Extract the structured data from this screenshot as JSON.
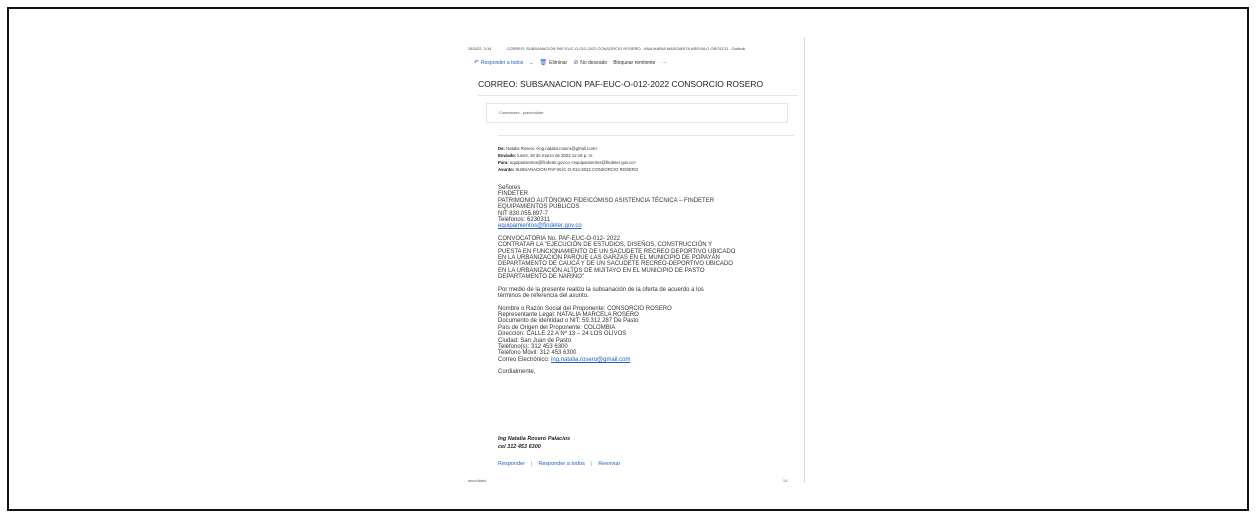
{
  "header": {
    "datetime": "28/3/22, 3:34",
    "title": "CORREO: SUBSANACION PAF-EUC-O-012-2022 CONSORCIO ROSERO - ANA MARIA MARGARITA AREVALO OROZCO - Outlook"
  },
  "toolbar": {
    "reply_all": "Responder a todos",
    "delete": "Eliminar",
    "junk": "No deseado",
    "block": "Bloquear remitente"
  },
  "message": {
    "subject": "CORREO: SUBSANACION PAF-EUC-O-012-2022 CONSORCIO ROSERO",
    "connectors": "Conectores - placeholder",
    "from": "Natalia Rosero <ing.natalia.rosero@gmail.com>",
    "sent": "lunes, 28 de marzo de 2022 12:16 p. m.",
    "to": "equipamientos@findeter.gov.co <equipamientos@findeter.gov.co>",
    "re": "SUBSANACION PAF-EUC-O-012-2022 CONSORCIO ROSERO",
    "label_from": "De:",
    "label_sent": "Enviado:",
    "label_to": "Para:",
    "label_re": "Asunto:"
  },
  "body": {
    "greeting": [
      "Señores",
      "FINDETER",
      "PATRIMONIO AUTÓNOMO FIDEICOMISO ASISTENCIA TÉCNICA – FINDETER",
      "EQUIPAMIENTOS PÚBLICOS",
      "NIT 830.055.897-7",
      "Teléfonos: 6230311"
    ],
    "email": "equipamientos@findeter.gov.co",
    "convocatoria": [
      "CONVOCATORIA No. PAF-EUC-O-012- 2022",
      "CONTRATAR LA \"EJECUCIÓN DE ESTUDIOS, DISEÑOS, CONSTRUCCIÓN Y",
      "PUESTA EN FUNCIONAMIENTO DE UN SACUDETE RECREO DEPORTIVO UBICADO",
      "EN LA URBANIZACIÓN PARQUE LAS GARZAS EN EL MUNICIPIO DE POPAYÁN",
      "DEPARTAMENTO DE CAUCA Y DE UN SACUDETE RECREO-DEPORTIVO UBICADO",
      "EN LA URBANIZACIÓN ALTOS DE MIJITAYO EN EL MUNICIPIO DE PASTO",
      "DEPARTAMENTO DE NARIÑO\""
    ],
    "intro": [
      "Por medio de la presente realizo la subsanación de la oferta de acuerdo a los",
      "términos de referencia del asunto."
    ],
    "proponent": [
      "Nombre o Razón Social del Proponente: CONSORCIO ROSERO",
      "Representante Legal: NATALIA MARCELA ROSERO",
      "Documento de identidad o NIT: 59.312.287 De Pasto",
      "País de Origen del Proponente: COLOMBIA",
      "Dirección: CALLE 22 A Nº 13 – 24 LOS OLIVOS",
      "Ciudad: San Juan de Pasto",
      "Teléfono(s): 312 453 6300",
      "Teléfono Móvil: 312 453 6300"
    ],
    "mail_label": "Correo Electrónico:",
    "mail_value": "ing.natalia.rosero@gmail.com",
    "closing": "Cordialmente,",
    "signature_name": "Ing Natalia Rosero Palacios",
    "signature_phone": "cel 312 453 6300"
  },
  "actions": {
    "reply": "Responder",
    "reply_all": "Responder a todos",
    "forward": "Reenviar"
  },
  "footer": {
    "left": "about:blank",
    "right": "1/1"
  }
}
